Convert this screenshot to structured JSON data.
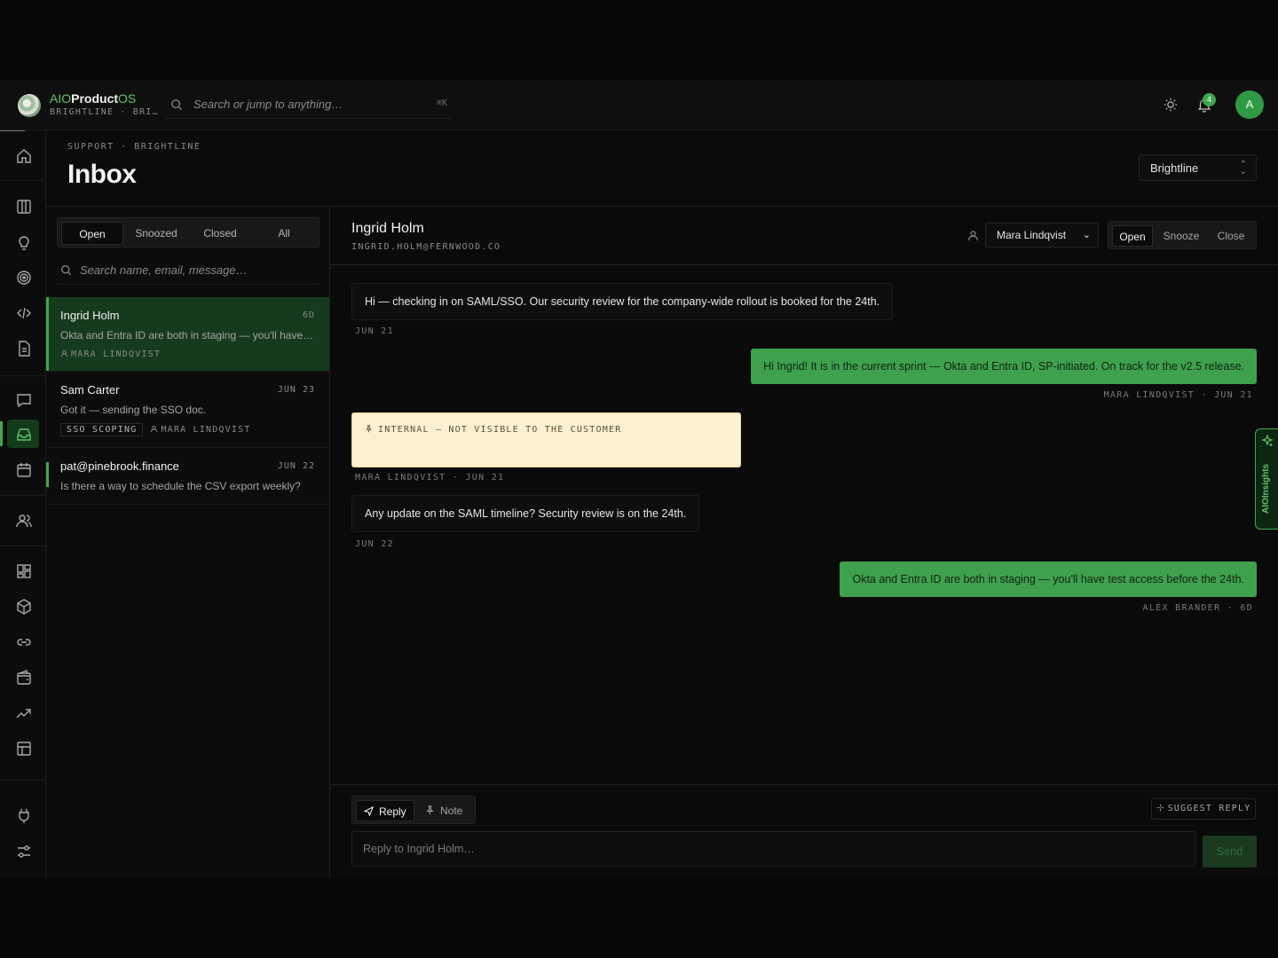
{
  "topbar": {
    "brand_a": "AIO",
    "brand_b": "Product",
    "brand_c": "OS",
    "workspace_short": "BRIGHTLINE · BRI…",
    "search_placeholder": "Search or jump to anything…",
    "search_shortcut": "⌘K",
    "notifications_count": "4",
    "avatar_initial": "A"
  },
  "page": {
    "breadcrumb": "SUPPORT · BRIGHTLINE",
    "title": "Inbox",
    "workspace_select": "Brightline"
  },
  "list": {
    "tabs": [
      "Open",
      "Snoozed",
      "Closed",
      "All"
    ],
    "active_tab": "Open",
    "search_placeholder": "Search name, email, message…",
    "conversations": [
      {
        "name": "Ingrid Holm",
        "time": "6D",
        "snippet": "Okta and Entra ID are both in staging — you'll have…",
        "tag": "",
        "assignee": "MARA LINDQVIST"
      },
      {
        "name": "Sam Carter",
        "time": "JUN 23",
        "snippet": "Got it — sending the SSO doc.",
        "tag": "SSO SCOPING",
        "assignee": "MARA LINDQVIST"
      },
      {
        "name": "pat@pinebrook.finance",
        "time": "JUN 22",
        "snippet": "Is there a way to schedule the CSV export weekly?",
        "tag": "",
        "assignee": ""
      }
    ]
  },
  "thread": {
    "name": "Ingrid Holm",
    "email": "INGRID.HOLM@FERNWOOD.CO",
    "assignee": "Mara Lindqvist",
    "status_options": [
      "Open",
      "Snooze",
      "Close"
    ],
    "status_active": "Open",
    "messages": [
      {
        "kind": "in",
        "text": "Hi — checking in on SAML/SSO. Our security review for the company-wide rollout is booked for the 24th.",
        "meta": "JUN 21"
      },
      {
        "kind": "out",
        "text": "Hi Ingrid! It is in the current sprint — Okta and Entra ID, SP-initiated. On track for the v2.5 release.",
        "meta": "MARA LINDQVIST · JUN 21"
      },
      {
        "kind": "note",
        "text": "INTERNAL — NOT VISIBLE TO THE CUSTOMER",
        "meta": "MARA LINDQVIST · JUN 21"
      },
      {
        "kind": "in",
        "text": "Any update on the SAML timeline? Security review is on the 24th.",
        "meta": "JUN 22"
      },
      {
        "kind": "out",
        "text": "Okta and Entra ID are both in staging — you'll have test access before the 24th.",
        "meta": "ALEX BRANDER · 6D"
      }
    ],
    "insights_label": "AIOInsights"
  },
  "composer": {
    "modes": [
      "Reply",
      "Note"
    ],
    "active_mode": "Reply",
    "suggest_label": "SUGGEST REPLY",
    "placeholder": "Reply to Ingrid Holm…",
    "send_label": "Send"
  },
  "colors": {
    "accent": "#3ea84d",
    "active_row": "#153a1d",
    "note_bg": "#fbf0cf"
  }
}
